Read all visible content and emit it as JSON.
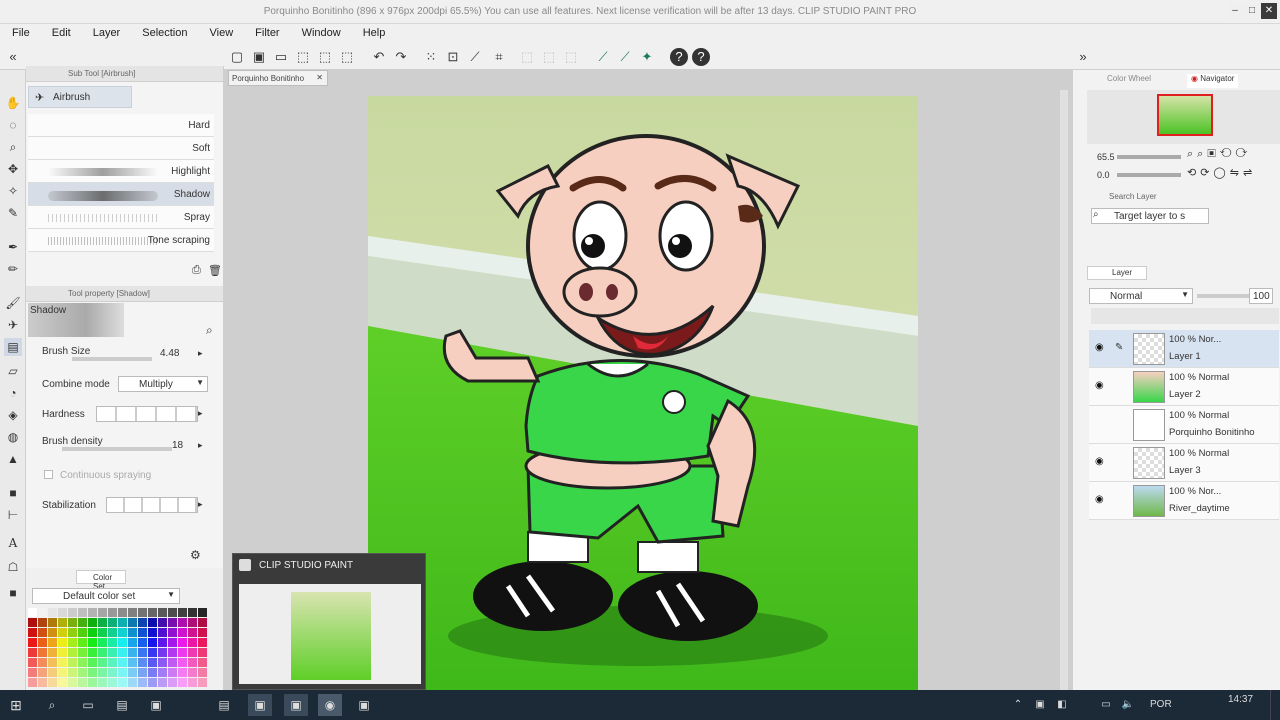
{
  "window": {
    "title": "Porquinho Bonitinho (896 x 976px 200dpi 65.5%)  You can use all features.  Next license verification will be after 13 days.  CLIP STUDIO PAINT PRO",
    "min_label": "–",
    "max_label": "□",
    "close_label": "✕"
  },
  "menu": [
    "File",
    "Edit",
    "Layer",
    "Selection",
    "View",
    "Filter",
    "Window",
    "Help"
  ],
  "subtool": {
    "header": "Sub Tool [Airbrush]",
    "group": "Airbrush",
    "brushes": [
      "Hard",
      "Soft",
      "Highlight",
      "Shadow",
      "Spray",
      "Tone scraping"
    ],
    "selected": "Shadow"
  },
  "toolprop": {
    "header": "Tool property [Shadow]",
    "name": "Shadow",
    "brush_size_label": "Brush Size",
    "brush_size_value": "4.48",
    "combine_label": "Combine mode",
    "combine_value": "Multiply",
    "hardness_label": "Hardness",
    "density_label": "Brush density",
    "density_value": "18",
    "continuous_label": "Continuous spraying",
    "stabilization_label": "Stabilization"
  },
  "colorset": {
    "tab": "Color Set",
    "name": "Default color set"
  },
  "document": {
    "tab": "Porquinho Bonitinho"
  },
  "popup": {
    "title": "CLIP STUDIO PAINT"
  },
  "navigator": {
    "tab_color": "Color Wheel",
    "tab_nav": "Navigator",
    "zoom_value": "65.5",
    "rotate_value": "0.0"
  },
  "search": {
    "label": "Search Layer",
    "target_placeholder": "Target layer to s"
  },
  "layers_panel": {
    "tab": "Layer",
    "blend_mode": "Normal",
    "opacity": "100",
    "layers": [
      {
        "pct": "100 %  Nor...",
        "name": "Layer 1",
        "visible": true,
        "selected": true
      },
      {
        "pct": "100 %  Normal",
        "name": "Layer 2",
        "visible": true,
        "selected": false
      },
      {
        "pct": "100 %  Normal",
        "name": "Porquinho Bonitinho",
        "visible": false,
        "selected": false
      },
      {
        "pct": "100 %  Normal",
        "name": "Layer 3",
        "visible": true,
        "selected": false
      },
      {
        "pct": "100 %  Nor...",
        "name": "River_daytime",
        "visible": true,
        "selected": false
      }
    ]
  },
  "taskbar": {
    "time": "14:37",
    "lang": "POR"
  },
  "colors": {
    "accent": "#2d7dd2",
    "jersey": "#39d64a",
    "pig": "#f7cfc0"
  }
}
